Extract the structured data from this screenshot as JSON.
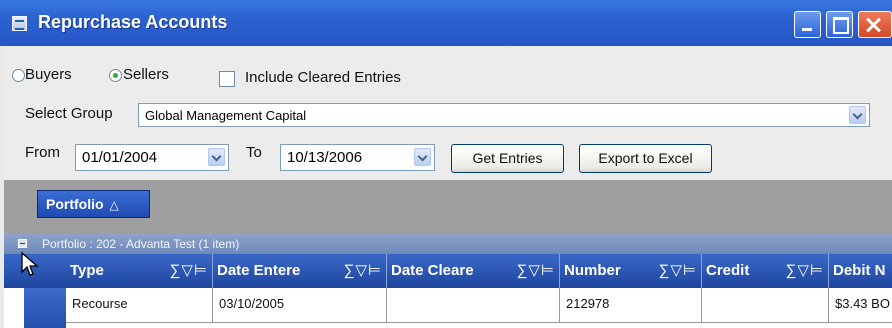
{
  "window": {
    "title": "Repurchase Accounts"
  },
  "options": {
    "buyers_label": "Buyers",
    "sellers_label": "Sellers",
    "selected_party": "Sellers",
    "include_cleared_label": "Include Cleared Entries",
    "include_cleared_checked": false,
    "select_group_label": "Select Group",
    "group_value": "Global Management Capital",
    "from_label": "From",
    "from_value": "01/01/2004",
    "to_label": "To",
    "to_value": "10/13/2006",
    "get_entries_label": "Get Entries",
    "export_label": "Export to Excel"
  },
  "grouping": {
    "chip_label": "Portfolio",
    "sort_icon": "sort-ascending-triangle",
    "group_row_text": "Portfolio : 202 - Advanta Test (1 item)"
  },
  "grid": {
    "columns": [
      "Type",
      "Date Entere",
      "Date Cleare",
      "Number",
      "Credit",
      "Debit N"
    ],
    "column_icons": [
      "sum-icon",
      "filter-icon",
      "pin-icon"
    ],
    "rows": [
      {
        "type": "Recourse",
        "date_entered": "03/10/2005",
        "date_cleared": "",
        "number": "212978",
        "credit": "",
        "debit": "$3.43 BO"
      }
    ]
  },
  "colors": {
    "titlebar": "#2b62d0",
    "grid_header": "#2a54b0",
    "panel_bg": "#ececec",
    "group_area": "#9f9f9f"
  }
}
